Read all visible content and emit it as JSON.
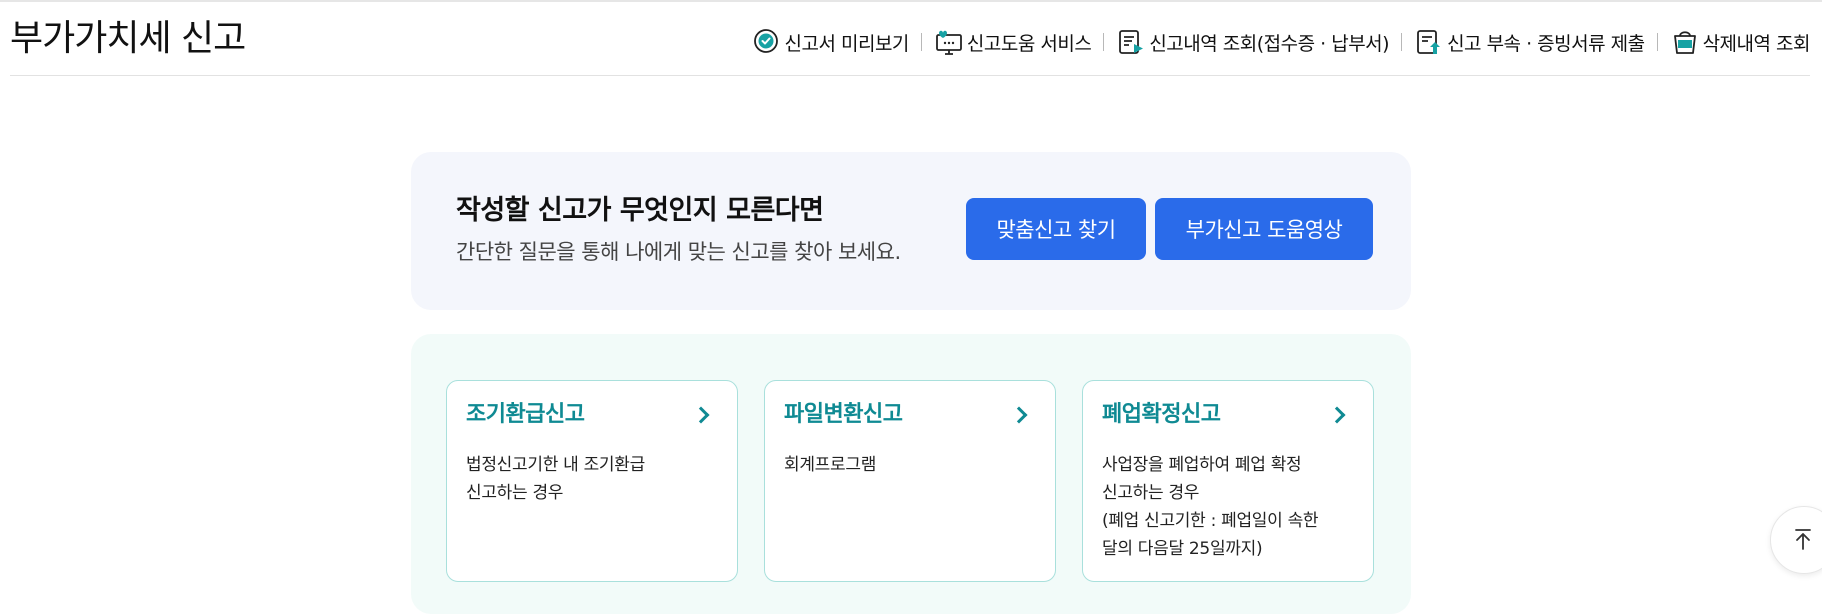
{
  "header": {
    "title": "부가가치세 신고",
    "menu": [
      {
        "label": "신고서 미리보기",
        "icon": "preview-check-icon"
      },
      {
        "label": "신고도움 서비스",
        "icon": "monitor-heart-icon"
      },
      {
        "label": "신고내역 조회(접수증 · 납부서)",
        "icon": "document-list-icon"
      },
      {
        "label": "신고 부속 · 증빙서류 제출",
        "icon": "document-upload-icon"
      },
      {
        "label": "삭제내역 조회",
        "icon": "trash-basket-icon"
      }
    ]
  },
  "help": {
    "title": "작성할 신고가 무엇인지 모른다면",
    "desc": "간단한 질문을 통해 나에게 맞는 신고를 찾아 보세요.",
    "find_button": "맞춤신고 찾기",
    "video_button": "부가신고 도움영상"
  },
  "cards": [
    {
      "title": "조기환급신고",
      "lines": [
        "법정신고기한 내 조기환급",
        "신고하는 경우"
      ]
    },
    {
      "title": "파일변환신고",
      "lines": [
        "회계프로그램"
      ]
    },
    {
      "title": "폐업확정신고",
      "lines": [
        "사업장을 폐업하여 폐업 확정",
        "신고하는 경우",
        "(폐업 신고기한 : 폐업일이 속한",
        "달의 다음달 25일까지)"
      ]
    }
  ],
  "colors": {
    "accent": "#2a6bea",
    "card_title": "#0f8a93",
    "help_bg": "#f4f6fc",
    "cards_bg": "#f2fbf9",
    "icon_teal": "#17a2a4"
  },
  "scroll_top_icon": "arrow-up-to-top-icon"
}
